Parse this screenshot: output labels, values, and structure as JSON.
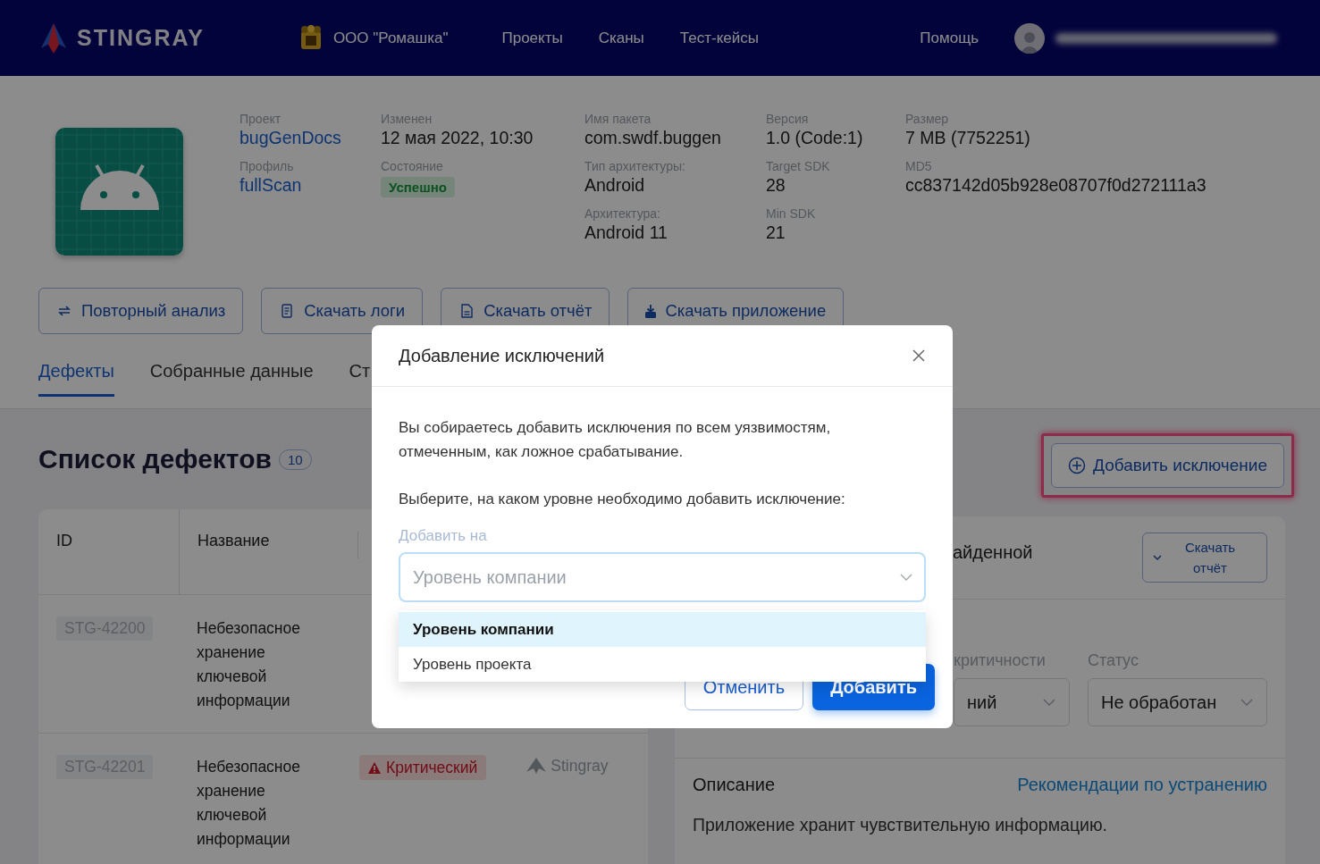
{
  "header": {
    "logo": "STINGRAY",
    "organization": "ООО \"Ромашка\"",
    "nav": [
      {
        "label": "Проекты"
      },
      {
        "label": "Сканы"
      },
      {
        "label": "Тест-кейсы"
      }
    ],
    "help": "Помощь"
  },
  "project": {
    "columns": [
      [
        {
          "label": "Проект",
          "value": "bugGenDocs",
          "kind": "link"
        },
        {
          "label": "Профиль",
          "value": "fullScan",
          "kind": "link"
        }
      ],
      [
        {
          "label": "Изменен",
          "value": "12 мая 2022, 10:30",
          "kind": "text"
        },
        {
          "label": "Состояние",
          "value": "Успешно",
          "kind": "badge"
        }
      ],
      [
        {
          "label": "Имя пакета",
          "value": "com.swdf.buggen",
          "kind": "text"
        },
        {
          "label": "Тип архитектуры:",
          "value": "Android",
          "kind": "text"
        },
        {
          "label": "Архитектура:",
          "value": "Android 11",
          "kind": "text"
        }
      ],
      [
        {
          "label": "Версия",
          "value": "1.0 (Code:1)",
          "kind": "text"
        },
        {
          "label": "Target SDK",
          "value": "28",
          "kind": "text"
        },
        {
          "label": "Min SDK",
          "value": "21",
          "kind": "text"
        }
      ],
      [
        {
          "label": "Размер",
          "value": "7 MB (7752251)",
          "kind": "text"
        },
        {
          "label": "MD5",
          "value": "cc837142d05b928e08707f0d272111a3",
          "kind": "text"
        }
      ]
    ],
    "actions": [
      {
        "label": "Повторный анализ",
        "kind": "repeat"
      },
      {
        "label": "Скачать логи",
        "kind": "log"
      },
      {
        "label": "Скачать отчёт",
        "kind": "report"
      },
      {
        "label": "Скачать приложение",
        "kind": "download"
      }
    ]
  },
  "tabs": [
    {
      "label": "Дефекты",
      "selected": true
    },
    {
      "label": "Собранные данные",
      "selected": false
    },
    {
      "label": "Ст",
      "selected": false
    }
  ],
  "defects": {
    "title": "Список дефектов",
    "count": "10",
    "add_button": "Добавить исключение",
    "columns": [
      "ID",
      "Название"
    ],
    "rows": [
      {
        "id": "STG-42200",
        "name": "Небезопасное хранение ключевой информации"
      },
      {
        "id": "STG-42201",
        "name": "Небезопасное хранение ключевой информации",
        "severity": "Критический",
        "source": "Stingray"
      }
    ]
  },
  "detail": {
    "heading": "айденной",
    "download_button": "Скачать отчёт",
    "filters": [
      {
        "label": "критичности",
        "value": "ний"
      },
      {
        "label": "Статус",
        "value": "Не обработан"
      }
    ],
    "description_title": "Описание",
    "recommendations_link": "Рекомендации по устранению",
    "description": "Приложение хранит чувствительную информацию."
  },
  "modal": {
    "title": "Добавление исключений",
    "paragraphs": [
      "Вы собираетесь добавить исключения по всем уязвимостям, отмеченным, как ложное срабатывание.",
      "Выберите, на каком уровне необходимо добавить исключение:"
    ],
    "field_label": "Добавить на",
    "placeholder": "Уровень компании",
    "expanded": true,
    "options": [
      {
        "label": "Уровень компании",
        "selected": true
      },
      {
        "label": "Уровень проекта",
        "selected": false
      }
    ],
    "buttons": [
      {
        "label": "Отменить",
        "kind": "secondary"
      },
      {
        "label": "Добавить",
        "kind": "primary"
      }
    ]
  }
}
